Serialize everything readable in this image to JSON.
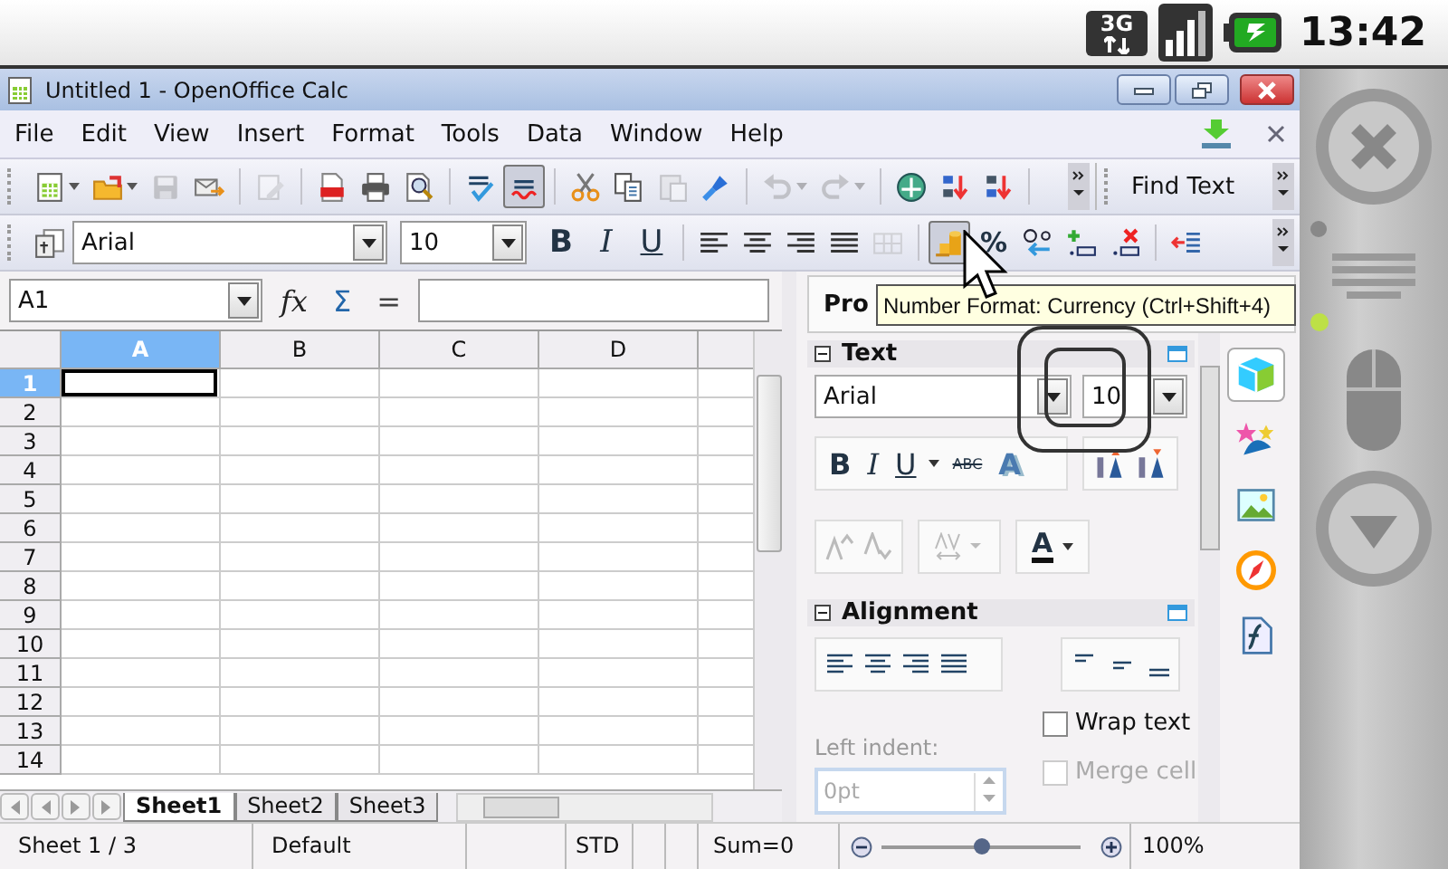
{
  "phone_status": {
    "network": "3G",
    "time": "13:42"
  },
  "window": {
    "title": "Untitled 1 - OpenOffice Calc"
  },
  "menu": [
    {
      "label": "File"
    },
    {
      "label": "Edit"
    },
    {
      "label": "View"
    },
    {
      "label": "Insert"
    },
    {
      "label": "Format"
    },
    {
      "label": "Tools"
    },
    {
      "label": "Data"
    },
    {
      "label": "Window"
    },
    {
      "label": "Help"
    }
  ],
  "standard_toolbar": [
    {
      "kind": "new",
      "disabled": false,
      "pressed": false,
      "dropdown": true
    },
    {
      "kind": "open",
      "disabled": false,
      "pressed": false,
      "dropdown": true
    },
    {
      "kind": "save",
      "disabled": true,
      "pressed": false,
      "dropdown": false
    },
    {
      "kind": "email",
      "disabled": false,
      "pressed": false,
      "dropdown": false
    },
    {
      "kind": "separator"
    },
    {
      "kind": "edit",
      "disabled": true,
      "pressed": false,
      "dropdown": false
    },
    {
      "kind": "separator"
    },
    {
      "kind": "pdf",
      "disabled": false,
      "pressed": false,
      "dropdown": false
    },
    {
      "kind": "print",
      "disabled": false,
      "pressed": false,
      "dropdown": false
    },
    {
      "kind": "preview",
      "disabled": false,
      "pressed": false,
      "dropdown": false
    },
    {
      "kind": "separator"
    },
    {
      "kind": "spell",
      "disabled": false,
      "pressed": false,
      "dropdown": false
    },
    {
      "kind": "autospell",
      "disabled": false,
      "pressed": true,
      "dropdown": false
    },
    {
      "kind": "separator"
    },
    {
      "kind": "cut",
      "disabled": false,
      "pressed": false,
      "dropdown": false
    },
    {
      "kind": "copy",
      "disabled": false,
      "pressed": false,
      "dropdown": false
    },
    {
      "kind": "paste",
      "disabled": true,
      "pressed": false,
      "dropdown": false
    },
    {
      "kind": "brush",
      "disabled": false,
      "pressed": false,
      "dropdown": false
    },
    {
      "kind": "separator"
    },
    {
      "kind": "undo",
      "disabled": true,
      "pressed": false,
      "dropdown": true
    },
    {
      "kind": "redo",
      "disabled": true,
      "pressed": false,
      "dropdown": true
    },
    {
      "kind": "separator"
    },
    {
      "kind": "navigator",
      "disabled": false,
      "pressed": false,
      "dropdown": false
    },
    {
      "kind": "sortasc",
      "disabled": false,
      "pressed": false,
      "dropdown": false
    },
    {
      "kind": "sortdesc",
      "disabled": false,
      "pressed": false,
      "dropdown": false
    },
    {
      "kind": "separator"
    }
  ],
  "find_toolbar": {
    "label": "Find Text"
  },
  "formatting_toolbar": [
    {
      "kind": "styles",
      "disabled": false,
      "pressed": false
    },
    {
      "kind": "font_name",
      "value": "Arial"
    },
    {
      "kind": "font_size",
      "value": "10"
    },
    {
      "kind": "bold",
      "label": "B",
      "disabled": false,
      "pressed": false
    },
    {
      "kind": "italic",
      "label": "I",
      "disabled": false,
      "pressed": false
    },
    {
      "kind": "underline",
      "label": "U",
      "disabled": false,
      "pressed": false
    },
    {
      "kind": "separator"
    },
    {
      "kind": "align_left",
      "disabled": false,
      "pressed": false
    },
    {
      "kind": "align_center",
      "disabled": false,
      "pressed": false
    },
    {
      "kind": "align_right",
      "disabled": false,
      "pressed": false
    },
    {
      "kind": "justify",
      "disabled": false,
      "pressed": false
    },
    {
      "kind": "merge",
      "disabled": true,
      "pressed": false
    },
    {
      "kind": "separator"
    },
    {
      "kind": "currency",
      "disabled": false,
      "pressed": true
    },
    {
      "kind": "percent",
      "label": "%",
      "disabled": false,
      "pressed": false
    },
    {
      "kind": "currency_percent",
      "disabled": false,
      "pressed": false
    },
    {
      "kind": "add_decimal",
      "disabled": false,
      "pressed": false
    },
    {
      "kind": "del_decimal",
      "disabled": false,
      "pressed": false
    },
    {
      "kind": "separator"
    },
    {
      "kind": "indent_dec",
      "disabled": false,
      "pressed": false
    }
  ],
  "formula_bar": {
    "cell": "A1",
    "buttons": [
      {
        "kind": "wizard",
        "label": "fx"
      },
      {
        "kind": "sum",
        "label": "Σ"
      },
      {
        "kind": "equals",
        "label": "="
      }
    ]
  },
  "sheet": {
    "columns": [
      {
        "label": "A",
        "selected": true
      },
      {
        "label": "B",
        "selected": false
      },
      {
        "label": "C",
        "selected": false
      },
      {
        "label": "D",
        "selected": false
      }
    ],
    "rows": [
      {
        "label": "1",
        "selected": true
      },
      {
        "label": "2",
        "selected": false
      },
      {
        "label": "3",
        "selected": false
      },
      {
        "label": "4",
        "selected": false
      },
      {
        "label": "5",
        "selected": false
      },
      {
        "label": "6",
        "selected": false
      },
      {
        "label": "7",
        "selected": false
      },
      {
        "label": "8",
        "selected": false
      },
      {
        "label": "9",
        "selected": false
      },
      {
        "label": "10",
        "selected": false
      },
      {
        "label": "11",
        "selected": false
      },
      {
        "label": "12",
        "selected": false
      },
      {
        "label": "13",
        "selected": false
      },
      {
        "label": "14",
        "selected": false
      }
    ]
  },
  "sheet_tabs": [
    {
      "label": "Sheet1",
      "selected": true
    },
    {
      "label": "Sheet2",
      "selected": false
    },
    {
      "label": "Sheet3",
      "selected": false
    }
  ],
  "sidebar": {
    "title": "Pro",
    "tooltip": "Number Format: Currency (Ctrl+Shift+4)",
    "text_section": {
      "title": "Text",
      "expanded": true,
      "font": "Arial",
      "size": "10",
      "style_buttons": [
        {
          "kind": "bold",
          "label": "B"
        },
        {
          "kind": "italic",
          "label": "I"
        },
        {
          "kind": "underline",
          "label": "U"
        },
        {
          "kind": "strike",
          "label": "ABC"
        },
        {
          "kind": "shadow",
          "label": "A"
        }
      ],
      "font_color_label": "A"
    },
    "alignment_section": {
      "title": "Alignment",
      "expanded": true,
      "indent_label": "Left indent:",
      "indent_value": "0pt",
      "options": [
        {
          "label": "Wrap text",
          "checked": false,
          "disabled": false
        },
        {
          "label": "Merge cell",
          "checked": false,
          "disabled": true
        }
      ]
    },
    "deck_tabs": [
      {
        "kind": "properties",
        "selected": true
      },
      {
        "kind": "styles",
        "selected": false
      },
      {
        "kind": "gallery",
        "selected": false
      },
      {
        "kind": "navigator",
        "selected": false
      },
      {
        "kind": "functions",
        "selected": false
      }
    ]
  },
  "status_bar": {
    "sheet": "Sheet 1 / 3",
    "page_style": "Default",
    "selection_mode": "STD",
    "sum": "Sum=0",
    "zoom": {
      "level": 0.5
    },
    "zoom_percent": "100%"
  }
}
